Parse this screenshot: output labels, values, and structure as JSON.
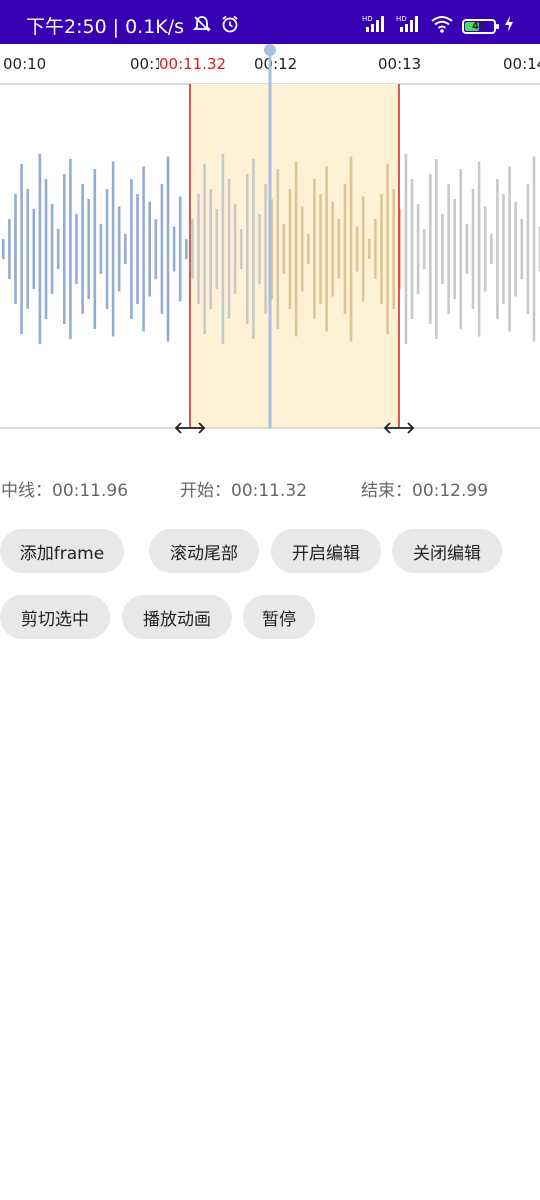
{
  "status_bar": {
    "time": "下午2:50",
    "speed": "0.1K/s",
    "battery": "47",
    "icons": [
      "mute-icon",
      "alarm-icon",
      "signal-icon",
      "signal-icon",
      "wifi-icon",
      "battery-icon",
      "charging-icon"
    ],
    "bg_color": "#3700b3"
  },
  "ruler": {
    "ticks": [
      "00:10",
      "00:11",
      "00:12",
      "00:13",
      "00:14"
    ],
    "selection_start_label": "00:11.32"
  },
  "info": {
    "center": "中线：00:11.96",
    "start": "开始：00:11.32",
    "end": "结束：00:12.99"
  },
  "buttons": {
    "add_frame": "添加frame",
    "scroll_end": "滚动尾部",
    "enable_edit": "开启编辑",
    "disable_edit": "关闭编辑",
    "cut_selection": "剪切选中",
    "play_animation": "播放动画",
    "pause": "暂停"
  },
  "colors": {
    "played_wave": "#92acd6",
    "selected_wave": "#dcc59a",
    "unplayed_wave": "#c9c9c9",
    "selection_fill": "#fff1d6",
    "selection_border": "#cc2222",
    "playhead": "#a9bfe2"
  }
}
